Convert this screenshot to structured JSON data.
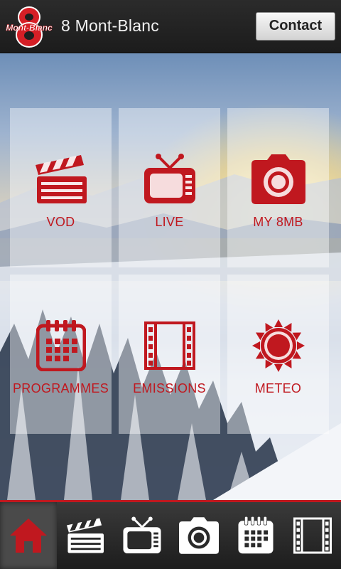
{
  "header": {
    "logo_text": "Mont-Blanc",
    "logo_digit": "8",
    "title": "8 Mont-Blanc",
    "contact_label": "Contact"
  },
  "tiles": [
    {
      "label": "VOD",
      "icon": "clapperboard-icon"
    },
    {
      "label": "LIVE",
      "icon": "tv-icon"
    },
    {
      "label": "MY 8MB",
      "icon": "camera-icon"
    },
    {
      "label": "PROGRAMMES",
      "icon": "calendar-icon"
    },
    {
      "label": "EMISSIONS",
      "icon": "film-strip-icon"
    },
    {
      "label": "METEO",
      "icon": "sun-icon"
    }
  ],
  "tabbar": {
    "items": [
      "home-icon",
      "clapperboard-icon",
      "tv-icon",
      "camera-icon",
      "calendar-icon",
      "film-strip-icon"
    ],
    "active": "home-icon"
  },
  "colors": {
    "accent": "#c0181f",
    "bar": "#1e1e1e",
    "tab_icon": "#ffffff"
  }
}
